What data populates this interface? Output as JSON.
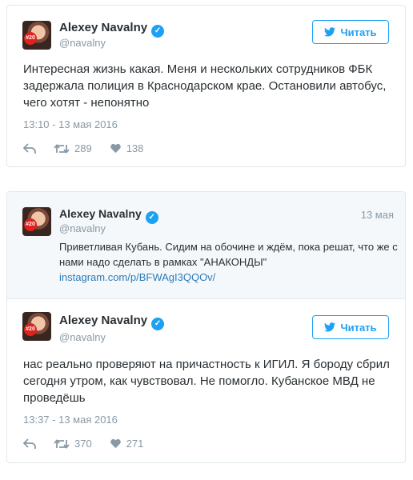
{
  "follow_label": "Читать",
  "tweet1": {
    "name": "Alexey Navalny",
    "handle": "@navalny",
    "badge": "#20",
    "text": "Интересная жизнь какая. Меня и нескольких сотрудников ФБК задержала полиция в Краснодарском крае. Остановили автобус, чего хотят - непонятно",
    "timestamp": "13:10 - 13 мая 2016",
    "retweets": "289",
    "likes": "138"
  },
  "quoted": {
    "name": "Alexey Navalny",
    "handle": "@navalny",
    "badge": "#20",
    "date": "13 мая",
    "text": "Приветливая Кубань. Сидим на обочине и ждём, пока решат, что же с нами надо сделать в рамках \"АНАКОНДЫ\"",
    "link": "instagram.com/p/BFWAgI3QQOv/"
  },
  "tweet2": {
    "name": "Alexey Navalny",
    "handle": "@navalny",
    "badge": "#20",
    "text": "нас реально проверяют на причастность к ИГИЛ. Я бороду сбрил сегодня утром, как чувствовал. Не помогло. Кубанское МВД не проведёшь",
    "timestamp": "13:37 - 13 мая 2016",
    "retweets": "370",
    "likes": "271"
  },
  "icons": {
    "reply": "reply-icon",
    "retweet": "retweet-icon",
    "like": "heart-icon",
    "bird": "twitter-bird-icon",
    "verified": "verified-badge-icon"
  },
  "colors": {
    "accent": "#1da1f2",
    "text": "#292f33",
    "muted": "#8899a6",
    "link": "#2b7bb9",
    "quote_bg": "#f5f8fa"
  }
}
